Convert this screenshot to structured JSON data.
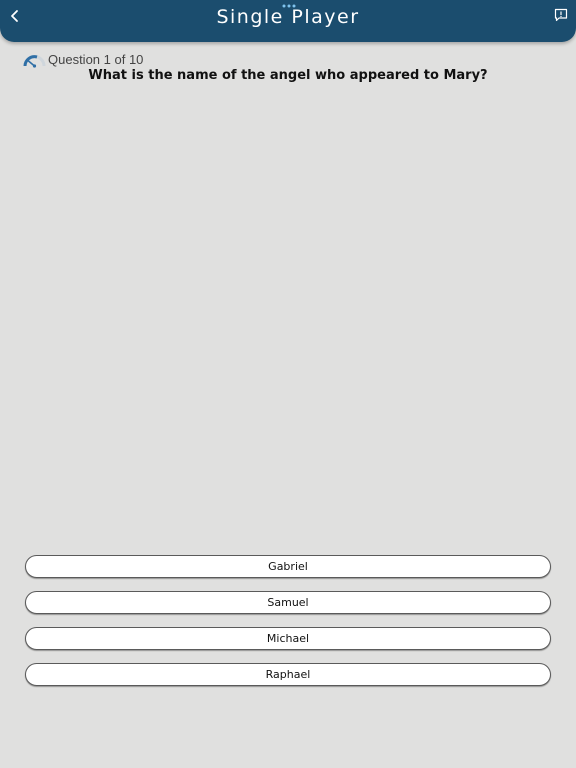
{
  "header": {
    "title": "Single Player",
    "back_icon": "chevron-left-icon",
    "feedback_icon": "feedback-icon",
    "background_color": "#1b4d6e"
  },
  "quiz": {
    "progress_label": "Question 1 of 10",
    "timer_icon": "speedometer-icon",
    "question": "What is the name of the angel who appeared to Mary?",
    "answers": [
      "Gabriel",
      "Samuel",
      "Michael",
      "Raphael"
    ]
  }
}
